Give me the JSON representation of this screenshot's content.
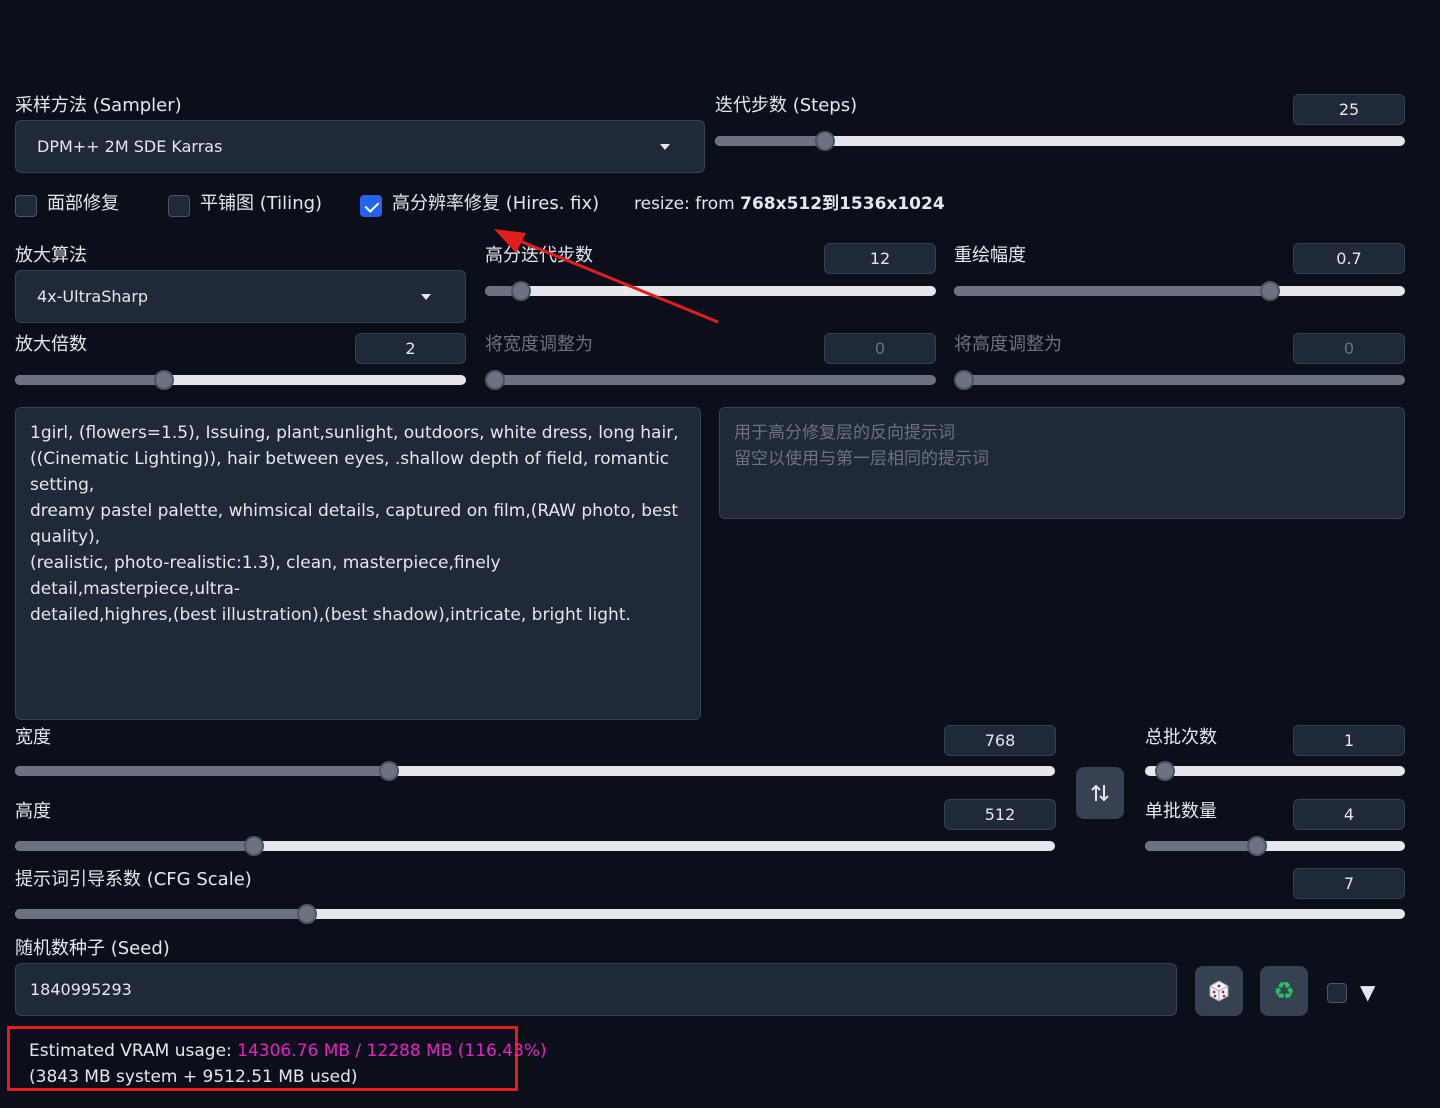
{
  "sampler": {
    "label": "采样方法 (Sampler)",
    "value": "DPM++ 2M SDE Karras"
  },
  "steps": {
    "label": "迭代步数 (Steps)",
    "value": "25",
    "fraction": 0.16
  },
  "checkboxes": {
    "restore_faces": {
      "label": "面部修复",
      "checked": false
    },
    "tiling": {
      "label": "平铺图 (Tiling)",
      "checked": false
    },
    "hires_fix": {
      "label": "高分辨率修复 (Hires. fix)",
      "checked": true
    }
  },
  "resize_info": {
    "prefix": "resize: from ",
    "value": "768x512到1536x1024"
  },
  "upscaler": {
    "label": "放大算法",
    "value": "4x-UltraSharp"
  },
  "hires_steps": {
    "label": "高分迭代步数",
    "value": "12",
    "fraction": 0.08
  },
  "denoise": {
    "label": "重绘幅度",
    "value": "0.7",
    "fraction": 0.7
  },
  "upscale_by": {
    "label": "放大倍数",
    "value": "2",
    "fraction": 0.33
  },
  "resize_width": {
    "label": "将宽度调整为",
    "value": "0",
    "fraction": 0.0
  },
  "resize_height": {
    "label": "将高度调整为",
    "value": "0",
    "fraction": 0.0
  },
  "prompt": {
    "value": "1girl, (flowers=1.5), Issuing, plant,sunlight, outdoors, white dress, long hair,\n((Cinematic Lighting)), hair between eyes, .shallow depth of field, romantic setting,\ndreamy pastel palette, whimsical details, captured on film,(RAW photo, best quality),\n(realistic, photo-realistic:1.3), clean, masterpiece,finely detail,masterpiece,ultra-\ndetailed,highres,(best illustration),(best shadow),intricate, bright light."
  },
  "hires_negative_prompt": {
    "placeholder": "用于高分修复层的反向提示词\n留空以使用与第一层相同的提示词"
  },
  "width": {
    "label": "宽度",
    "value": "768",
    "fraction": 0.36
  },
  "height": {
    "label": "高度",
    "value": "512",
    "fraction": 0.23
  },
  "swap_icon": "swap-dimensions-icon",
  "batch_count": {
    "label": "总批次数",
    "value": "1",
    "fraction": 0.0
  },
  "batch_size": {
    "label": "单批数量",
    "value": "4",
    "fraction": 0.43
  },
  "cfg": {
    "label": "提示词引导系数 (CFG Scale)",
    "value": "7",
    "fraction": 0.21
  },
  "seed": {
    "label": "随机数种子 (Seed)",
    "value": "1840995293",
    "random_icon": "dice-icon",
    "reuse_icon": "recycle-icon",
    "extra_toggle": "▼"
  },
  "vram": {
    "prefix": "Estimated VRAM usage: ",
    "highlight": "14306.76 MB / 12288 MB (116.43%)",
    "detail": "(3843 MB system + 9512.51 MB used)"
  },
  "colors": {
    "accent": "#2563eb",
    "background": "#0b0f19",
    "warning": "#e91ec9",
    "annotation": "#e11d1d"
  }
}
